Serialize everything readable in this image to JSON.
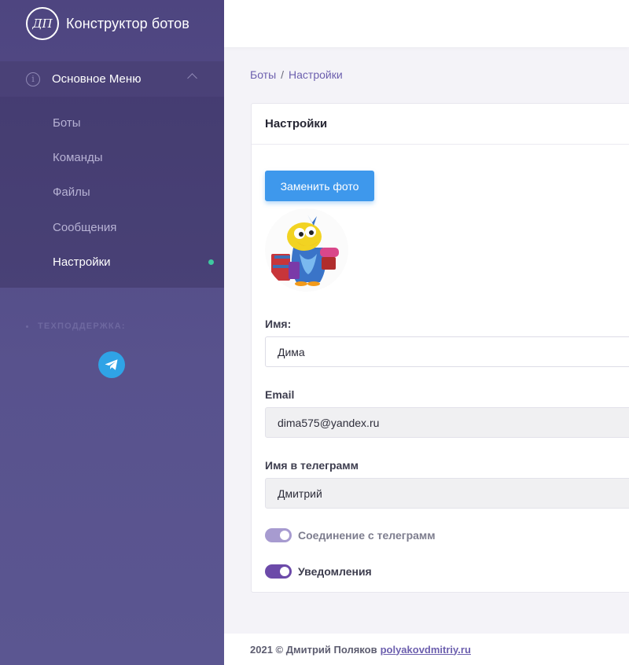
{
  "brand": {
    "logo_text": "ДП",
    "title": "Конструктор ботов"
  },
  "sidebar": {
    "section_title": "Основное Меню",
    "items": [
      {
        "label": "Боты",
        "active": false
      },
      {
        "label": "Команды",
        "active": false
      },
      {
        "label": "Файлы",
        "active": false
      },
      {
        "label": "Сообщения",
        "active": false
      },
      {
        "label": "Настройки",
        "active": true
      }
    ],
    "support_label": "ТЕХПОДДЕРЖКА:"
  },
  "breadcrumb": {
    "root": "Боты",
    "separator": "/",
    "current": "Настройки"
  },
  "card": {
    "title": "Настройки",
    "photo_button": "Заменить фото",
    "name_label": "Имя:",
    "name_value": "Дима",
    "email_label": "Email",
    "email_value": "dima575@yandex.ru",
    "telegram_name_label": "Имя в телеграмм",
    "telegram_name_value": "Дмитрий",
    "toggle_telegram_label": "Соединение с телеграмм",
    "toggle_telegram_on": true,
    "toggle_notify_label": "Уведомления",
    "toggle_notify_on": true
  },
  "footer": {
    "text": "2021 © Дмитрий Поляков",
    "link": "polyakovdmitriy.ru"
  },
  "colors": {
    "accent": "#6c5fae",
    "button": "#3e98ec",
    "active_dot": "#3ec9a0",
    "telegram": "#2fa3e6"
  },
  "icons": [
    "info-icon",
    "chevron-up-icon",
    "telegram-icon",
    "avatar-bird-image"
  ]
}
